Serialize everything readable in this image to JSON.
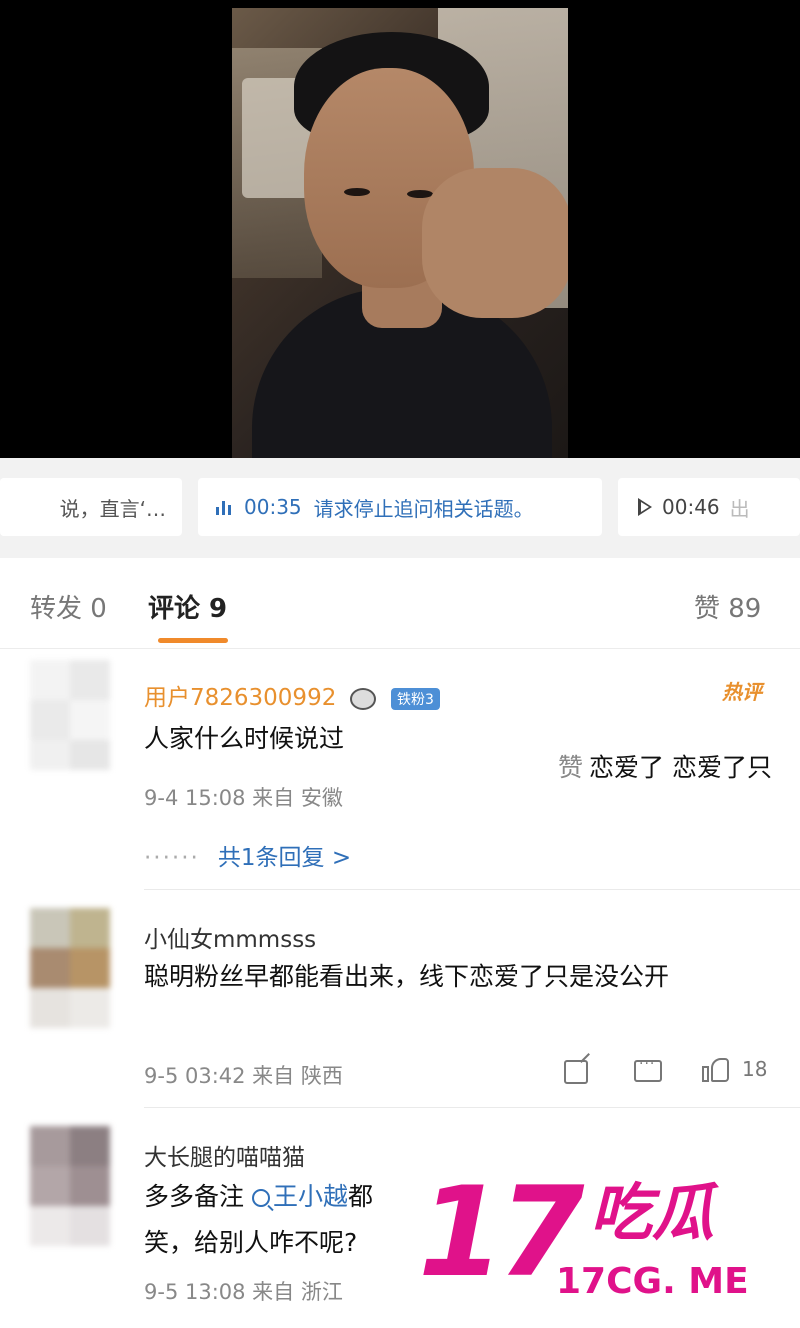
{
  "audio_strip": {
    "left_chip_text": "说，直言‘…",
    "mid_chip_time": "00:35",
    "mid_chip_text": "请求停止追问相关话题。",
    "right_chip_time": "00:46",
    "right_chip_text": "出"
  },
  "tabs": {
    "repost": "转发 0",
    "comments": "评论 9",
    "likes": "赞 89"
  },
  "comments": [
    {
      "username": "用户7826300992",
      "username_color": "#e8902e",
      "badge": "铁粉3",
      "text": "人家什么时候说过",
      "meta": "9-4 15:08 来自 安徽",
      "replies": "共1条回复 >",
      "replies_dots": "······",
      "hot_label": "热评",
      "side_zan": "赞",
      "side_text": "恋爱了 恋爱了只"
    },
    {
      "username": "小仙女mmmsss",
      "username_color": "#333333",
      "text": "聪明粉丝早都能看出来，线下恋爱了只是没公开",
      "meta": "9-5 03:42 来自 陕西",
      "like_count": "18"
    },
    {
      "username": "大长腿的喵喵猫",
      "username_color": "#333333",
      "text_before": "多多备注",
      "mention": "王小越",
      "text_after": "都",
      "text_line2": "笑，给别人咋不呢?",
      "meta": "9-5 13:08 来自 浙江"
    }
  ],
  "watermark": {
    "number": "17",
    "chinese": "吃瓜",
    "url": "17CG. ME"
  }
}
